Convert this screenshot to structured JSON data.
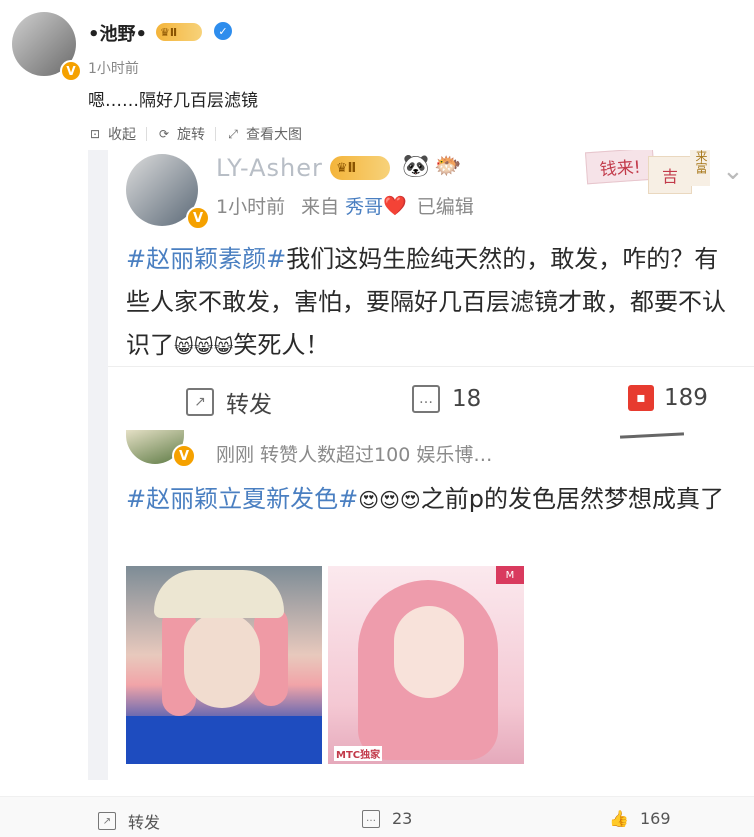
{
  "post": {
    "author": "•池野•",
    "crown_level": "Ⅱ",
    "time": "1小时前",
    "text": "嗯……隔好几百层滤镜"
  },
  "image_toolbar": {
    "collapse": "收起",
    "rotate": "旋转",
    "view_large": "查看大图"
  },
  "embedded": {
    "author": "LY-Asher",
    "crown_level": "Ⅱ",
    "emoji_panda": "🐼",
    "emoji_fish": "🐡",
    "tag1": "钱来!",
    "tag2": "吉",
    "tag3": "来富",
    "meta_time": "1小时前",
    "meta_from": "来自",
    "meta_source": "秀哥",
    "meta_heart": "❤️",
    "meta_edited": "已编辑",
    "text_hashtag": "#赵丽颖素颜#",
    "text_body": "我们这妈生脸纯天然的，敢发，咋的？有些人家不敢发，害怕，要隔好几百层滤镜才敢，都要不认识了",
    "text_emojis": "😸😸😸",
    "text_end": "笑死人！",
    "repost_label": "转发",
    "comment_count": "18",
    "like_count": "189",
    "repost": {
      "meta": "刚刚  转赞人数超过100  娱乐博…",
      "hashtag": "#赵丽颖立夏新发色#",
      "emojis": "😍😍😍",
      "text": "之前p的发色居然梦想成真了",
      "watermark": "MTC独家"
    }
  },
  "actions": {
    "repost": "转发",
    "comments": "23",
    "likes": "169"
  }
}
